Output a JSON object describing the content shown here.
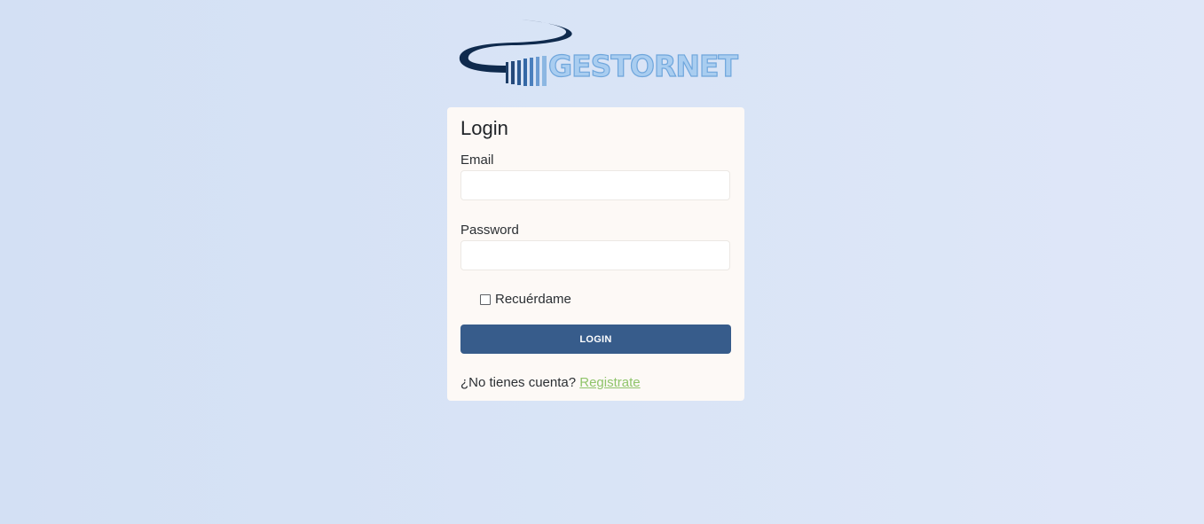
{
  "logo": {
    "text": "GESTORNET",
    "alt": "Gestornet logo",
    "colors": {
      "swoosh": "#0f2a4d",
      "bars": "#2f5f95",
      "text": "#a9cdf0"
    }
  },
  "login_form": {
    "title": "Login",
    "email_label": "Email",
    "email_value": "",
    "password_label": "Password",
    "password_value": "",
    "remember_label": "Recuérdame",
    "remember_checked": false,
    "login_button": "LOGIN",
    "no_account_text": "¿No tienes cuenta? ",
    "register_link": "Registrate"
  },
  "colors": {
    "background": "#d7e2f5",
    "card": "#fdf9f6",
    "button": "#375c8b",
    "link": "#8fc46a"
  }
}
